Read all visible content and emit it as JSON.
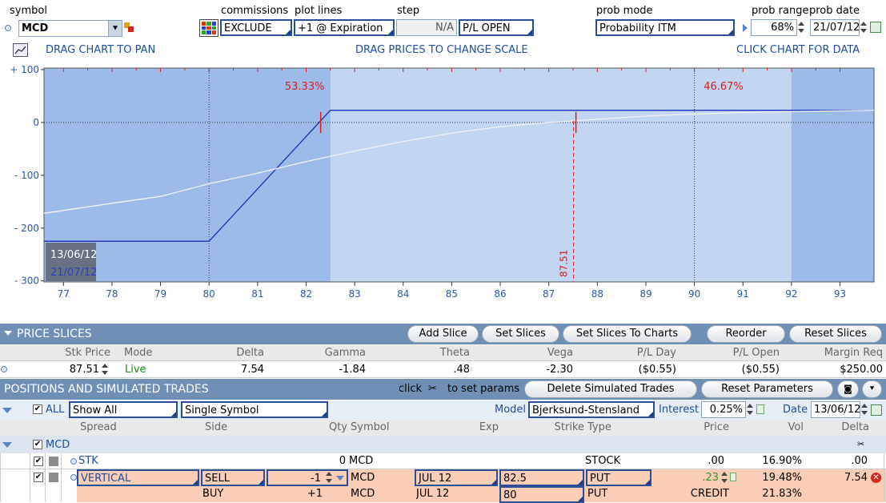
{
  "toolbar": {
    "symbol_label": "symbol",
    "symbol_value": "MCD",
    "commissions_label": "commissions",
    "commissions_value": "EXCLUDE",
    "plot_lines_label": "plot lines",
    "plot_lines_value": "+1 @ Expiration",
    "step_label": "step",
    "step_value": "N/A",
    "step_mode": "P/L OPEN",
    "prob_mode_label": "prob mode",
    "prob_mode_value": "Probability ITM",
    "prob_range_label": "prob range",
    "prob_range_value": "68%",
    "prob_date_label": "prob date",
    "prob_date_value": "21/07/12"
  },
  "chart_links": {
    "pan": "DRAG CHART TO PAN",
    "scale": "DRAG PRICES TO CHANGE SCALE",
    "data": "CLICK CHART FOR DATA"
  },
  "chart_data": {
    "type": "line",
    "x_ticks": [
      "77",
      "78",
      "79",
      "80",
      "81",
      "82",
      "83",
      "84",
      "85",
      "86",
      "87",
      "88",
      "89",
      "90",
      "91",
      "92",
      "93"
    ],
    "y_ticks": [
      "+ 100",
      "0",
      "- 100",
      "- 200",
      "- 300"
    ],
    "xlim": [
      76.6,
      93.7
    ],
    "ylim": [
      -302,
      103
    ],
    "prob_left_label": "53.33%",
    "prob_right_label": "46.67%",
    "prob_left_boundary": 82.3,
    "prob_right_boundary": 87.51,
    "range_band": [
      82.5,
      92.0
    ],
    "price_line_label": "87.51",
    "date_today": "13/06/12",
    "date_expiry": "21/07/12",
    "series": [
      {
        "name": "expiration",
        "color": "#1a2fb8",
        "points": [
          [
            76.6,
            -225
          ],
          [
            80,
            -225
          ],
          [
            82.5,
            23
          ],
          [
            93.7,
            23
          ]
        ]
      },
      {
        "name": "today",
        "color": "#f2f2f2",
        "points": [
          [
            76.6,
            -172
          ],
          [
            78,
            -153
          ],
          [
            79,
            -140
          ],
          [
            80,
            -116
          ],
          [
            81,
            -96
          ],
          [
            82,
            -74
          ],
          [
            83,
            -54
          ],
          [
            84,
            -36
          ],
          [
            85,
            -20
          ],
          [
            86,
            -8
          ],
          [
            87,
            0
          ],
          [
            88,
            6
          ],
          [
            89,
            12
          ],
          [
            90,
            16
          ],
          [
            91,
            19
          ],
          [
            92,
            21
          ],
          [
            93.7,
            23
          ]
        ]
      }
    ]
  },
  "price_slices": {
    "title": "PRICE SLICES",
    "buttons": [
      "Add Slice",
      "Set Slices",
      "Set Slices To Charts",
      "Reorder",
      "Reset Slices"
    ],
    "columns": [
      "Stk Price",
      "Mode",
      "Delta",
      "Gamma",
      "Theta",
      "Vega",
      "P/L Day",
      "P/L Open",
      "Margin Req"
    ],
    "row": {
      "stk_price": "87.51",
      "mode": "Live",
      "delta": "7.54",
      "gamma": "-1.84",
      "theta": ".48",
      "vega": "-2.30",
      "pl_day": "($0.55)",
      "pl_open": "($0.55)",
      "margin": "$250.00"
    }
  },
  "positions": {
    "title": "POSITIONS AND SIMULATED TRADES",
    "click_text": "click",
    "set_params_text": "to set params",
    "delete_btn": "Delete Simulated Trades",
    "reset_btn": "Reset Parameters",
    "all_label": "ALL",
    "show_value": "Show All",
    "symbol_filter": "Single Symbol",
    "model_label": "Model",
    "model_value": "Bjerksund-Stensland",
    "interest_label": "Interest",
    "interest_value": "0.25%",
    "date_label": "Date",
    "date_value": "13/06/12",
    "columns": [
      "Spread",
      "Side",
      "Qty",
      "Symbol",
      "Exp",
      "Strike",
      "Type",
      "Price",
      "Vol",
      "Delta"
    ],
    "group": "MCD",
    "rows": [
      {
        "spread": "STK",
        "side": "",
        "qty": "0",
        "symbol": "MCD",
        "exp": "",
        "strike": "",
        "type": "STOCK",
        "price": ".00",
        "vol": "16.90%",
        "delta": ".00"
      },
      {
        "spread": "VERTICAL",
        "side": "SELL",
        "qty": "-1",
        "symbol": "MCD",
        "exp": "JUL 12",
        "strike": "82.5",
        "type": "PUT",
        "price": ".23",
        "vol": "19.48%",
        "delta": "7.54"
      },
      {
        "spread": "",
        "side": "BUY",
        "qty": "+1",
        "symbol": "MCD",
        "exp": "JUL 12",
        "strike": "80",
        "type": "PUT",
        "price": "CREDIT",
        "vol": "21.83%",
        "delta": ""
      }
    ]
  }
}
